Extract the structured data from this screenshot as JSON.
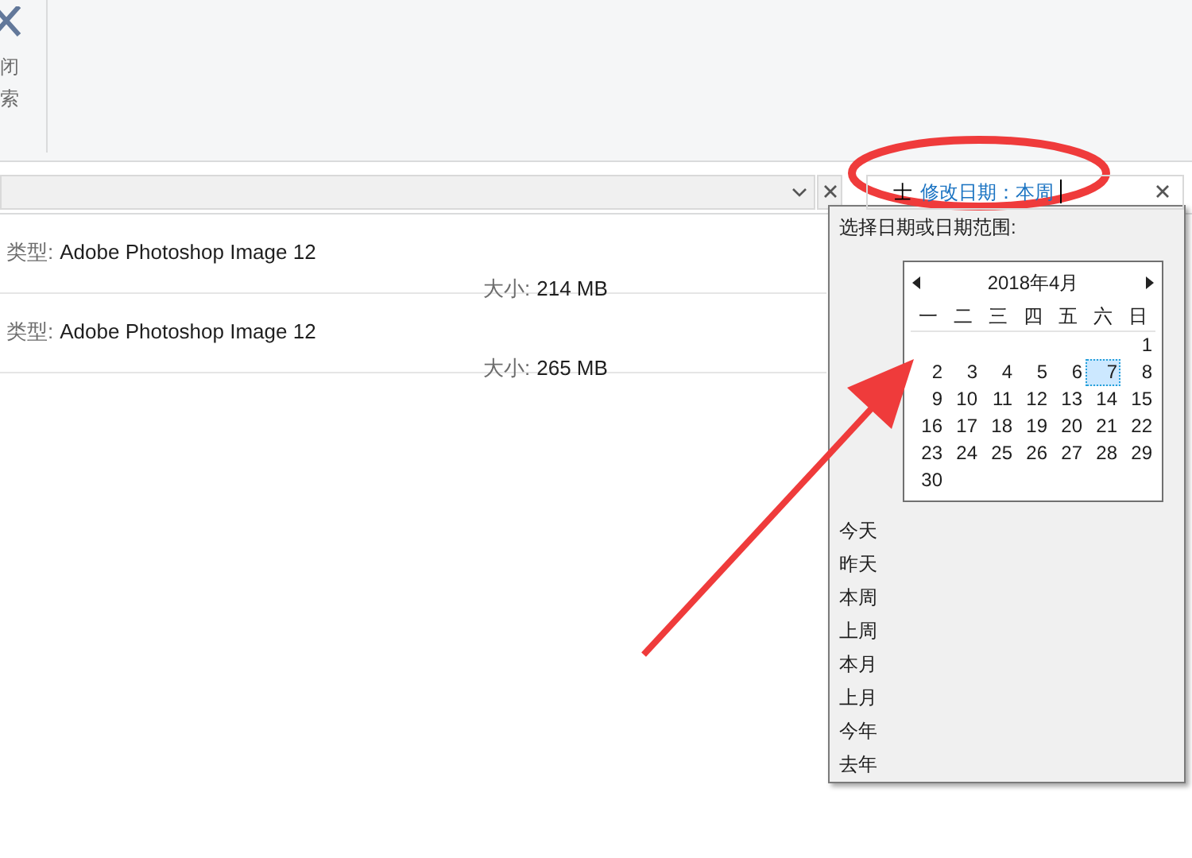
{
  "ribbon": {
    "close_search": {
      "lines": [
        "闭",
        "索"
      ]
    }
  },
  "search": {
    "parts": [
      {
        "text": "士",
        "kind": "keyword"
      },
      {
        "text": "修改日期：本周",
        "kind": "filter"
      }
    ]
  },
  "results": [
    {
      "type_label": "类型:",
      "type": "Adobe Photoshop Image 12",
      "size_label": "大小:",
      "size": "214 MB"
    },
    {
      "type_label": "类型:",
      "type": "Adobe Photoshop Image 12",
      "size_label": "大小:",
      "size": "265 MB"
    }
  ],
  "date_picker": {
    "prompt": "选择日期或日期范围:",
    "calendar": {
      "month": "2018年4月",
      "weekdays": [
        "一",
        "二",
        "三",
        "四",
        "五",
        "六",
        "日"
      ],
      "weeks": [
        [
          {
            "label": "1",
            "selected": false
          }
        ],
        [
          {
            "label": "2",
            "selected": false
          },
          {
            "label": "3",
            "selected": false
          },
          {
            "label": "4",
            "selected": false
          },
          {
            "label": "5",
            "selected": false
          },
          {
            "label": "6",
            "selected": false
          },
          {
            "label": "7",
            "selected": true
          },
          {
            "label": "8",
            "selected": false
          }
        ],
        [
          {
            "label": "9",
            "selected": false
          },
          {
            "label": "10",
            "selected": false
          },
          {
            "label": "11",
            "selected": false
          },
          {
            "label": "12",
            "selected": false
          },
          {
            "label": "13",
            "selected": false
          },
          {
            "label": "14",
            "selected": false
          },
          {
            "label": "15",
            "selected": false
          }
        ],
        [
          {
            "label": "16",
            "selected": false
          },
          {
            "label": "17",
            "selected": false
          },
          {
            "label": "18",
            "selected": false
          },
          {
            "label": "19",
            "selected": false
          },
          {
            "label": "20",
            "selected": false
          },
          {
            "label": "21",
            "selected": false
          },
          {
            "label": "22",
            "selected": false
          }
        ],
        [
          {
            "label": "23",
            "selected": false
          },
          {
            "label": "24",
            "selected": false
          },
          {
            "label": "25",
            "selected": false
          },
          {
            "label": "26",
            "selected": false
          },
          {
            "label": "27",
            "selected": false
          },
          {
            "label": "28",
            "selected": false
          },
          {
            "label": "29",
            "selected": false
          }
        ],
        [
          {
            "label": "30",
            "selected": false
          }
        ]
      ]
    },
    "presets": [
      "今天",
      "昨天",
      "本周",
      "上周",
      "本月",
      "上月",
      "今年",
      "去年"
    ]
  }
}
